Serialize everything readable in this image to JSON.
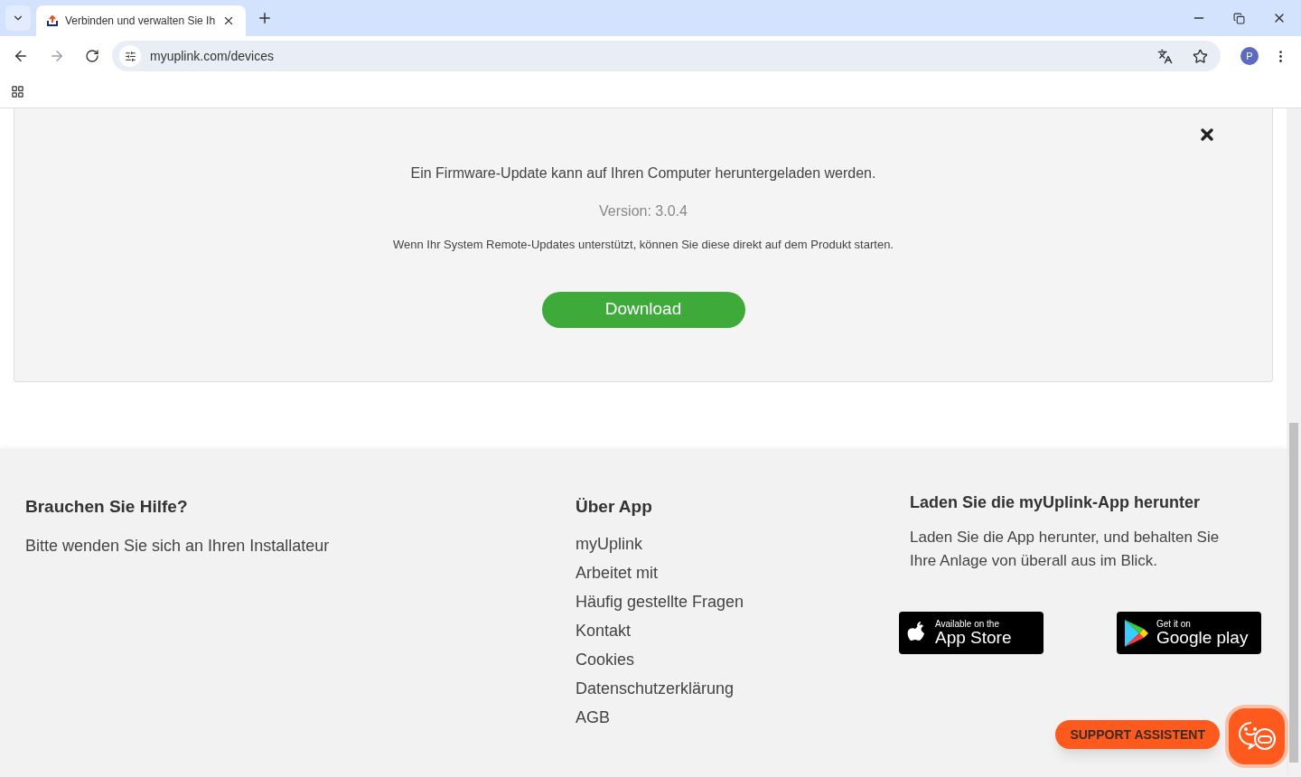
{
  "browser": {
    "tab_title": "Verbinden und verwalten Sie Ih",
    "url": "myuplink.com/devices",
    "profile_initial": "P"
  },
  "update_card": {
    "message": "Ein Firmware-Update kann auf Ihren Computer heruntergeladen werden.",
    "version": "Version: 3.0.4",
    "note": "Wenn Ihr System Remote-Updates unterstützt, können Sie diese direkt auf dem Produkt starten.",
    "button": "Download"
  },
  "footer": {
    "help": {
      "title": "Brauchen Sie Hilfe?",
      "text": "Bitte wenden Sie sich an Ihren Installateur"
    },
    "about": {
      "title": "Über App",
      "links": [
        "myUplink",
        "Arbeitet mit",
        "Häufig gestellte Fragen",
        "Kontakt",
        "Cookies",
        "Datenschutzerklärung",
        "AGB"
      ]
    },
    "app": {
      "title": "Laden Sie die myUplink-App herunter",
      "text": "Laden Sie die App herunter, und behalten Sie Ihre Anlage von überall aus im Blick.",
      "badges": [
        {
          "kind": "apple",
          "small": "Available on the",
          "large": "App Store"
        },
        {
          "kind": "google",
          "small": "Get it on",
          "large": "Google play"
        }
      ]
    }
  },
  "support": {
    "label": "SUPPORT ASSISTENT"
  }
}
